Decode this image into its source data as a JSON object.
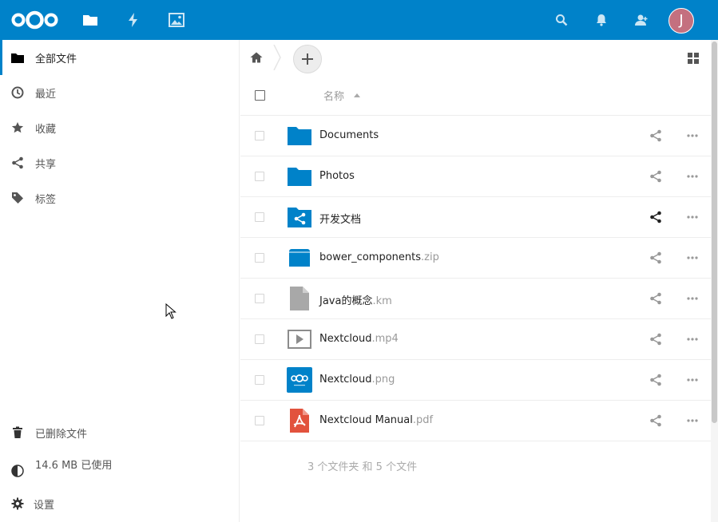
{
  "header": {
    "apps": [
      {
        "name": "files-app-icon"
      },
      {
        "name": "activity-app-icon"
      },
      {
        "name": "gallery-app-icon"
      }
    ],
    "user_initial": "J",
    "brand_color": "#0082c9",
    "avatar_color": "#c4707f"
  },
  "sidebar": {
    "items": [
      {
        "label": "全部文件",
        "icon": "folder-icon"
      },
      {
        "label": "最近",
        "icon": "clock-icon"
      },
      {
        "label": "收藏",
        "icon": "star-icon"
      },
      {
        "label": "共享",
        "icon": "share-icon"
      },
      {
        "label": "标签",
        "icon": "tag-icon"
      }
    ],
    "footer": {
      "deleted_label": "已删除文件",
      "quota_label": "14.6 MB 已使用",
      "settings_label": "设置"
    }
  },
  "list": {
    "column_name": "名称",
    "files": [
      {
        "name": "Documents",
        "ext": "",
        "type": "folder"
      },
      {
        "name": "Photos",
        "ext": "",
        "type": "folder"
      },
      {
        "name": "开发文档",
        "ext": "",
        "type": "shared-folder"
      },
      {
        "name": "bower_components",
        "ext": ".zip",
        "type": "archive"
      },
      {
        "name": "Java的概念",
        "ext": ".km",
        "type": "file"
      },
      {
        "name": "Nextcloud",
        "ext": ".mp4",
        "type": "video"
      },
      {
        "name": "Nextcloud",
        "ext": ".png",
        "type": "image"
      },
      {
        "name": "Nextcloud Manual",
        "ext": ".pdf",
        "type": "pdf"
      }
    ],
    "summary": "3 个文件夹 和 5 个文件"
  }
}
